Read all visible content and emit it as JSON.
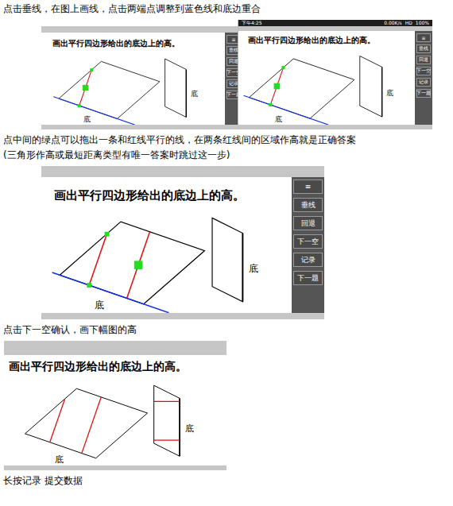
{
  "document": {
    "blocks": [
      {
        "kind": "text",
        "lines": [
          "点击垂线，在图上画线，点击两端点调整到蓝色线和底边重合"
        ]
      },
      {
        "kind": "screens",
        "screens": [
          {
            "kind": "tablet",
            "title": "画出平行四边形给出的底边上的高。",
            "menu": [
              {
                "label": "≡"
              },
              {
                "label": "垂线"
              },
              {
                "label": "回退"
              },
              {
                "label": "下一空"
              },
              {
                "label": "记录"
              },
              {
                "label": "下一题"
              }
            ],
            "figures": [
              {
                "kind": "rhombus",
                "label": "底",
                "base_line": true,
                "heights": 1,
                "handles": true
              },
              {
                "kind": "tall",
                "label": "底",
                "base_line": false,
                "heights": 0,
                "handles": false
              }
            ]
          },
          {
            "kind": "phone",
            "status_bar": {
              "time": "下午4:25",
              "network": "0.00K/s",
              "signal": "HD",
              "battery": "100%"
            },
            "title": "画出平行四边形给出的底边上的高。",
            "menu": [
              {
                "label": "≡"
              },
              {
                "label": "垂线"
              },
              {
                "label": "回退"
              },
              {
                "label": "下一空"
              },
              {
                "label": "记录"
              },
              {
                "label": "下一题"
              }
            ],
            "figures": [
              {
                "kind": "rhombus",
                "label": "底",
                "base_line": true,
                "heights": 1,
                "handles": true
              },
              {
                "kind": "tall",
                "label": "底",
                "base_line": false,
                "heights": 0,
                "handles": false
              }
            ]
          }
        ]
      },
      {
        "kind": "text",
        "lines": [
          "点中间的绿点可以拖出一条和红线平行的线，在两条红线间的区域作高就是正确答案",
          "(三角形作高或最短距离类型有唯一答案时跳过这一步)"
        ]
      },
      {
        "kind": "screens",
        "screens": [
          {
            "kind": "large",
            "title": "画出平行四边形给出的底边上的高。",
            "menu": [
              {
                "label": "≡"
              },
              {
                "label": "垂线"
              },
              {
                "label": "回退"
              },
              {
                "label": "下一空"
              },
              {
                "label": "记录"
              },
              {
                "label": "下一题"
              }
            ],
            "figures": [
              {
                "kind": "rhombus",
                "label": "底",
                "base_line": true,
                "heights": 2,
                "handles": true
              },
              {
                "kind": "tall",
                "label": "底",
                "base_line": false,
                "heights": 0,
                "handles": false
              }
            ]
          }
        ]
      },
      {
        "kind": "text",
        "lines": [
          "点击下一空确认，画下幅图的高"
        ]
      },
      {
        "kind": "screens",
        "screens": [
          {
            "kind": "crop",
            "title": "画出平行四边形给出的底边上的高。",
            "menu": [],
            "figures": [
              {
                "kind": "rhombus",
                "label": "底",
                "base_line": false,
                "heights": 2,
                "handles": false
              },
              {
                "kind": "tall",
                "label": "底",
                "base_line": false,
                "heights": 2,
                "handles": false
              }
            ]
          }
        ]
      },
      {
        "kind": "text",
        "lines": [
          "长按记录 提交数据"
        ]
      }
    ]
  }
}
